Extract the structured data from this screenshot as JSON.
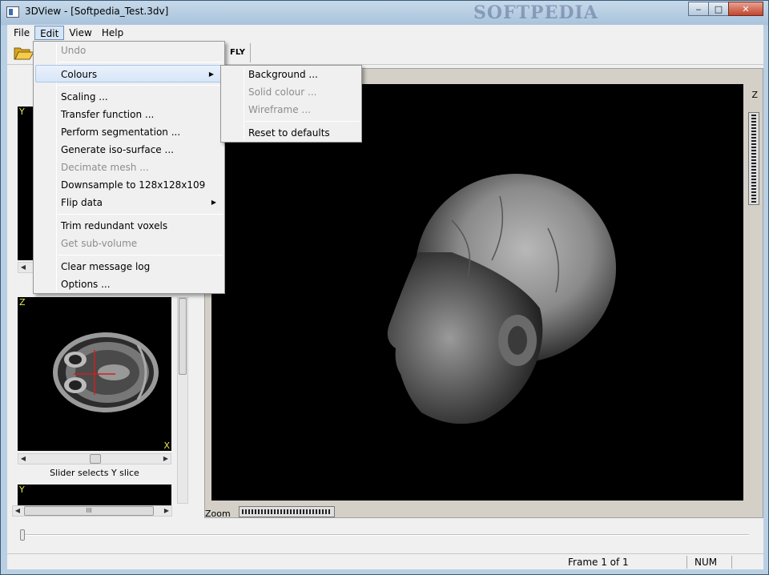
{
  "window": {
    "title": "3DView - [Softpedia_Test.3dv]",
    "watermark": "SOFTPEDIA",
    "minimize_glyph": "‒",
    "maximize_glyph": "□",
    "close_glyph": "✕"
  },
  "menubar": [
    "File",
    "Edit",
    "View",
    "Help"
  ],
  "toolbar": {
    "fly_label": "FLY",
    "open_icon": "folder-open-icon"
  },
  "edit_menu": {
    "items": [
      {
        "label": "Undo",
        "disabled": true
      },
      {
        "sep": true
      },
      {
        "label": "Colours",
        "submenu": true,
        "highlight": true
      },
      {
        "sep": true
      },
      {
        "label": "Scaling ..."
      },
      {
        "label": "Transfer function ..."
      },
      {
        "label": "Perform segmentation ..."
      },
      {
        "label": "Generate iso-surface ..."
      },
      {
        "label": "Decimate mesh ...",
        "disabled": true
      },
      {
        "label": "Downsample to 128x128x109"
      },
      {
        "label": "Flip data",
        "submenu": true
      },
      {
        "sep": true
      },
      {
        "label": "Trim redundant voxels"
      },
      {
        "label": "Get sub-volume",
        "disabled": true
      },
      {
        "sep": true
      },
      {
        "label": "Clear message log"
      },
      {
        "label": "Options ..."
      }
    ]
  },
  "colours_submenu": {
    "items": [
      {
        "label": "Background ..."
      },
      {
        "label": "Solid colour ...",
        "disabled": true
      },
      {
        "label": "Wireframe ...",
        "disabled": true
      },
      {
        "sep": true
      },
      {
        "label": "Reset to defaults"
      }
    ]
  },
  "left_panel": {
    "top_view_axis": "Y",
    "axial_view_axis_top": "Z",
    "axial_view_axis_bottom": "X",
    "slider_caption": "Slider selects Y slice",
    "bottom_view_axis": "Y",
    "scroll_grip": "III"
  },
  "main_view": {
    "z_label": "Z",
    "zoom_label": "Zoom"
  },
  "statusbar": {
    "frame": "Frame 1 of 1",
    "num": "NUM"
  },
  "colors": {
    "view_background": "#000000",
    "axis_label": "#e8e850",
    "crosshair": "#d02020"
  }
}
